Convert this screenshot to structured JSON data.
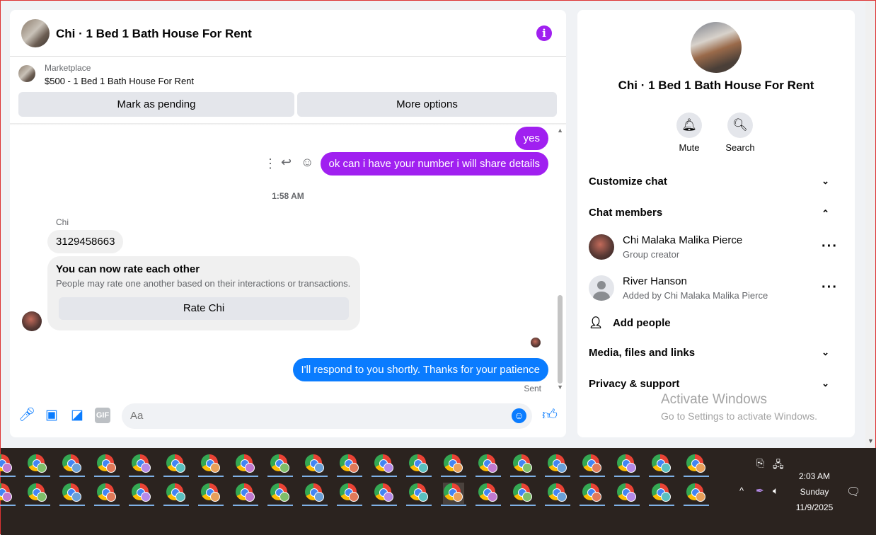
{
  "chat": {
    "title": "Chi · 1 Bed 1 Bath House For Rent",
    "info_icon": "info-icon",
    "marketplace_label": "Marketplace",
    "listing": "$500 - 1 Bed 1 Bath House For Rent",
    "buttons": {
      "pending": "Mark as pending",
      "more": "More options"
    },
    "messages": {
      "yes": "yes",
      "ask": "ok can i have your number i will share details",
      "time": "1:58 AM",
      "sender": "Chi",
      "number": "3129458663",
      "rate_title": "You can now rate each other",
      "rate_sub": "People may rate one another based on their interactions or transactions.",
      "rate_button": "Rate Chi",
      "reply": "I'll respond to you shortly. Thanks for your patience",
      "status": "Sent"
    },
    "composer_placeholder": "Aa"
  },
  "info": {
    "title": "Chi · 1 Bed 1 Bath House For Rent",
    "actions": {
      "mute": "Mute",
      "search": "Search"
    },
    "sections": {
      "customize": "Customize chat",
      "members": "Chat members",
      "media": "Media, files and links",
      "privacy": "Privacy & support"
    },
    "members": [
      {
        "name": "Chi Malaka Malika Pierce",
        "sub": "Group creator"
      },
      {
        "name": "River Hanson",
        "sub": "Added by Chi Malaka Malika Pierce"
      }
    ],
    "add_people": "Add people",
    "watermark": {
      "title": "Activate Windows",
      "sub": "Go to Settings to activate Windows."
    }
  },
  "taskbar": {
    "time": "2:03 AM",
    "day": "Sunday",
    "date": "11/9/2025",
    "app_icon": "chrome-icon"
  },
  "colors": {
    "accent": "#a020f0",
    "blue": "#0a7cff",
    "taskbar": "#2b231f"
  }
}
